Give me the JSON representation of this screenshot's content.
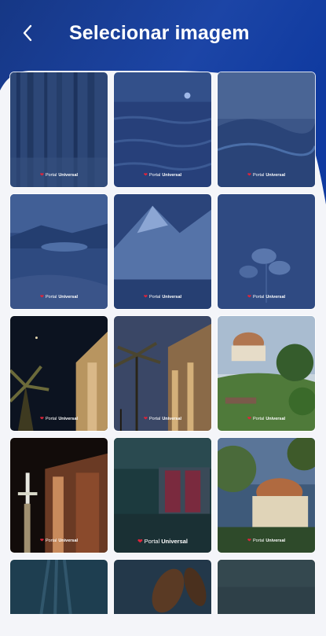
{
  "header": {
    "title": "Selecionar imagem",
    "back_icon": "chevron-left-icon"
  },
  "brand": {
    "heart": "❤",
    "name_light": "Portal",
    "name_bold": "Universal"
  },
  "colors": {
    "header_blue": "#1a3d94",
    "accent_red": "#e0243a",
    "background": "#f4f5f9"
  },
  "images": [
    {
      "id": "forest"
    },
    {
      "id": "sea-sunset"
    },
    {
      "id": "waves"
    },
    {
      "id": "lake-mountains"
    },
    {
      "id": "snow-mountain"
    },
    {
      "id": "white-flowers"
    },
    {
      "id": "temple-night-palm"
    },
    {
      "id": "temple-palm-dusk"
    },
    {
      "id": "domed-building-garden"
    },
    {
      "id": "temple-lamp-night"
    },
    {
      "id": "temple-entrance"
    },
    {
      "id": "dome-trees"
    },
    {
      "id": "underwater-light"
    },
    {
      "id": "leaves"
    },
    {
      "id": "dark-texture"
    }
  ]
}
